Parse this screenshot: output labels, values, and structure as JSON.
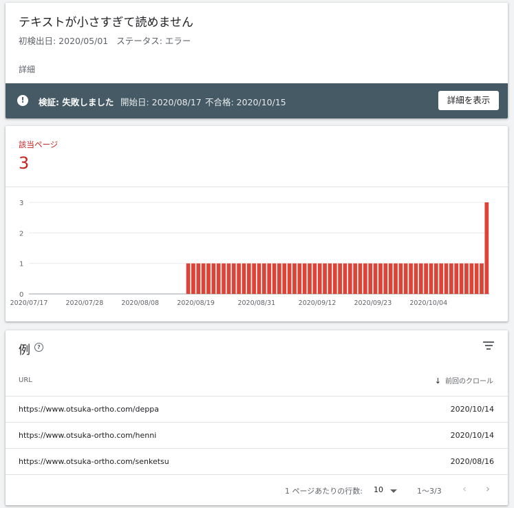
{
  "issue": {
    "title": "テキストが小さすぎて読めません",
    "first_detected": "初検出日: 2020/05/01",
    "status": "ステータス: エラー",
    "details_link": "詳細"
  },
  "validation": {
    "icon": "alert-circle-icon",
    "status": "検証: 失敗しました",
    "start_date": "開始日: 2020/08/17",
    "failed_date": "不合格: 2020/10/15",
    "button_label": "詳細を表示"
  },
  "metric": {
    "label": "該当ページ",
    "value": "3",
    "color": "#c5221f"
  },
  "chart_data": {
    "type": "bar",
    "x_ticks": [
      "2020/07/17",
      "2020/07/28",
      "2020/08/08",
      "2020/08/19",
      "2020/08/31",
      "2020/09/12",
      "2020/09/23",
      "2020/10/04"
    ],
    "y_ticks": [
      "0",
      "1",
      "2",
      "3"
    ],
    "ylim": [
      0,
      3
    ],
    "series": [
      {
        "color": "#db4437",
        "points": [
          {
            "from": "2020/07/17",
            "to": "2020/08/16",
            "value": 0
          },
          {
            "from": "2020/08/17",
            "to": "2020/10/14",
            "value": 1
          },
          {
            "from": "2020/10/15",
            "to": "2020/10/15",
            "value": 3
          }
        ]
      }
    ],
    "grid": true
  },
  "examples": {
    "title": "例",
    "help_icon": "help-circle-icon",
    "filter_icon": "filter-icon",
    "columns": {
      "url": "URL",
      "last_crawl": "前回のクロール",
      "sort_icon": "arrow-down-icon"
    },
    "rows": [
      {
        "url": "https://www.otsuka-ortho.com/deppa",
        "date": "2020/10/14"
      },
      {
        "url": "https://www.otsuka-ortho.com/henni",
        "date": "2020/10/14"
      },
      {
        "url": "https://www.otsuka-ortho.com/senketsu",
        "date": "2020/08/16"
      }
    ],
    "pagination": {
      "rows_per_page_label": "1 ページあたりの行数:",
      "rows_per_page": "10",
      "range": "1〜3/3",
      "prev_icon": "chevron-left-icon",
      "next_icon": "chevron-right-icon"
    }
  }
}
